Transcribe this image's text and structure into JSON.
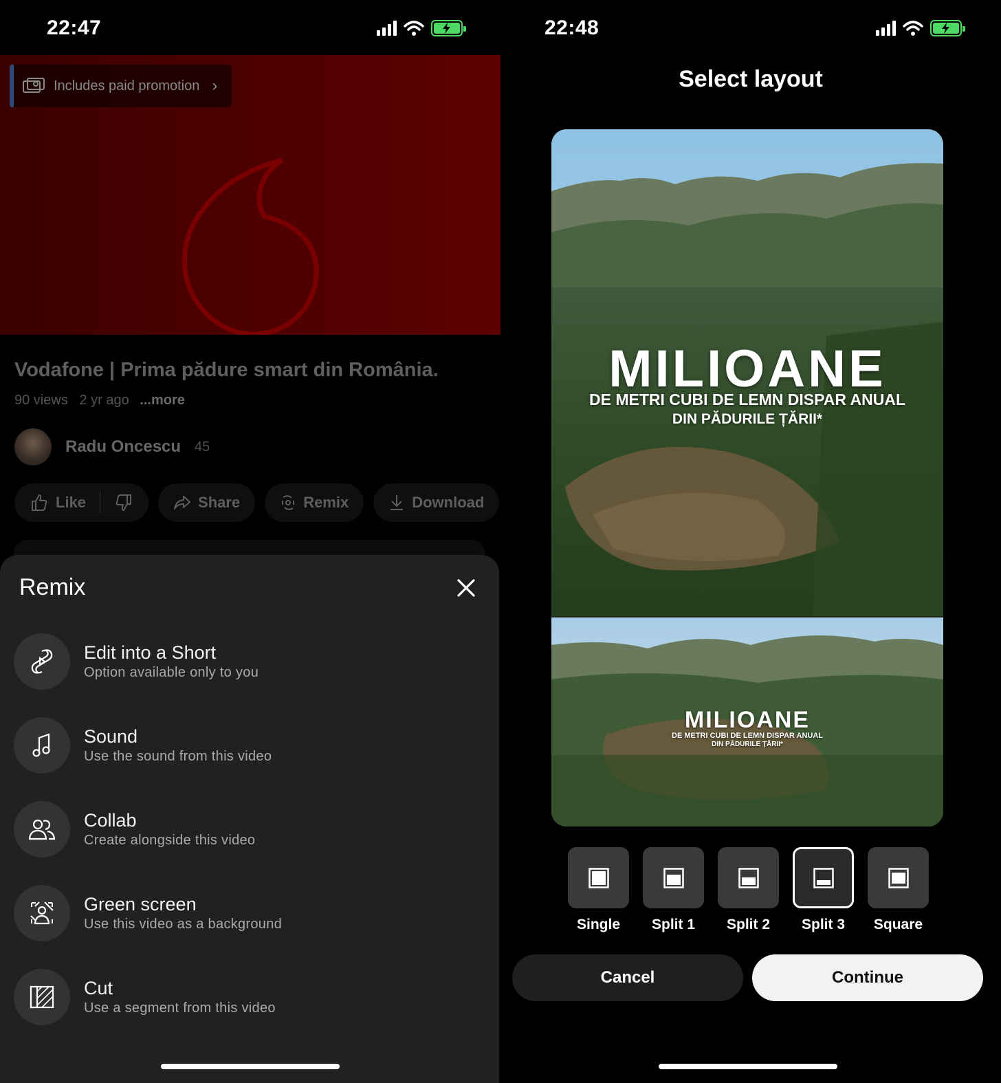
{
  "left": {
    "status": {
      "time": "22:47"
    },
    "promo": {
      "label": "Includes paid promotion"
    },
    "video": {
      "title": "Vodafone | Prima pădure smart din România.",
      "views": "90 views",
      "age": "2 yr ago",
      "more": "...more"
    },
    "channel": {
      "name": "Radu Oncescu",
      "subscribers": "45"
    },
    "actions": {
      "like": "Like",
      "share": "Share",
      "remix": "Remix",
      "download": "Download"
    },
    "remix_sheet": {
      "title": "Remix",
      "options": [
        {
          "title": "Edit into a Short",
          "subtitle": "Option available only to you",
          "icon": "shorts-icon"
        },
        {
          "title": "Sound",
          "subtitle": "Use the sound from this video",
          "icon": "music-note-icon"
        },
        {
          "title": "Collab",
          "subtitle": "Create alongside this video",
          "icon": "people-icon"
        },
        {
          "title": "Green screen",
          "subtitle": "Use this video as a background",
          "icon": "green-screen-icon"
        },
        {
          "title": "Cut",
          "subtitle": "Use a segment from this video",
          "icon": "cut-icon"
        }
      ]
    }
  },
  "right": {
    "status": {
      "time": "22:48"
    },
    "title": "Select layout",
    "preview_text": {
      "top_big": "MILIOANE",
      "top_line1": "DE METRI CUBI DE LEMN DISPAR ANUAL",
      "top_line2": "DIN PĂDURILE ȚĂRII*",
      "bottom_big": "MILIOANE",
      "bottom_line1": "DE METRI CUBI DE LEMN DISPAR ANUAL",
      "bottom_line2": "DIN PĂDURILE ȚĂRII*"
    },
    "layouts": [
      {
        "label": "Single",
        "selected": false
      },
      {
        "label": "Split 1",
        "selected": false
      },
      {
        "label": "Split 2",
        "selected": false
      },
      {
        "label": "Split 3",
        "selected": true
      },
      {
        "label": "Square",
        "selected": false
      }
    ],
    "buttons": {
      "cancel": "Cancel",
      "continue": "Continue"
    }
  },
  "colors": {
    "sheet_bg": "#212121",
    "icon_circle": "#333333",
    "battery": "#4cd964",
    "video_red": "#5c0000"
  }
}
